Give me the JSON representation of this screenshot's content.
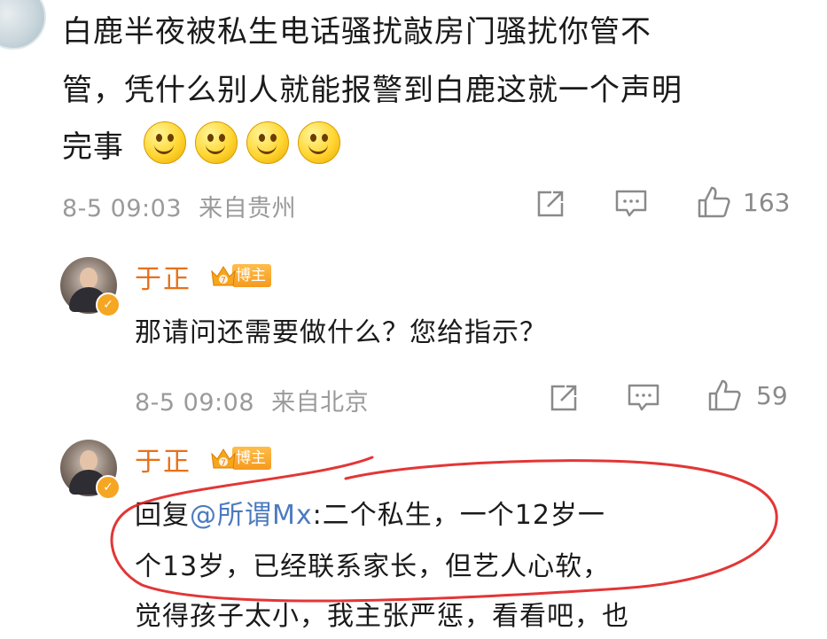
{
  "original_comment": {
    "text_line1": "白鹿半夜被私生电话骚扰敲房门骚扰你管不",
    "text_line2": "管，凭什么别人就能报警到白鹿这就一个声明",
    "text_line3": "完事",
    "emoji_count": 4,
    "time": "8-5 09:03",
    "source": "来自贵州",
    "like_count": "163"
  },
  "reply1": {
    "author": "于正",
    "badge": "博主",
    "text": "那请问还需要做什么？您给指示？",
    "time": "8-5 09:08",
    "source": "来自北京",
    "like_count": "59"
  },
  "reply2": {
    "author": "于正",
    "badge": "博主",
    "prefix": "回复",
    "mention": "@所谓Mx",
    "text_line1_rest": ":二个私生，一个12岁一",
    "text_line2": "个13岁，已经联系家长，但艺人心软，",
    "text_line3": "觉得孩子太小，我主张严惩，看看吧，也"
  },
  "colors": {
    "accent_name": "#e8701a",
    "mention": "#4c7bbf",
    "meta": "#9a9a9a",
    "annotation": "#e02020"
  },
  "icons": [
    "share-icon",
    "comment-icon",
    "like-icon",
    "verified-icon",
    "crown-icon"
  ]
}
